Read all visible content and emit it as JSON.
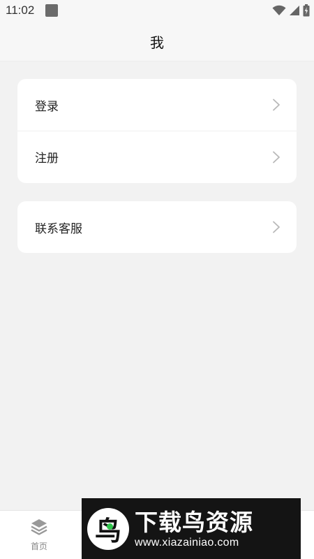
{
  "status_bar": {
    "time": "11:02",
    "icons": [
      "notification-icon",
      "wifi-icon",
      "signal-icon",
      "battery-charging-icon"
    ]
  },
  "header": {
    "title": "我"
  },
  "account_card": {
    "items": [
      {
        "label": "登录",
        "icon": "chevron-right-icon"
      },
      {
        "label": "注册",
        "icon": "chevron-right-icon"
      }
    ]
  },
  "support_card": {
    "items": [
      {
        "label": "联系客服",
        "icon": "chevron-right-icon"
      }
    ]
  },
  "tab_bar": {
    "home": {
      "label": "首页",
      "icon": "layers-icon"
    }
  },
  "watermark": {
    "logo_char": "鸟",
    "title": "下载鸟资源",
    "url": "www.xiazainiao.com"
  },
  "colors": {
    "background": "#f2f2f2",
    "card": "#ffffff",
    "chevron": "#b8b8b8",
    "watermark_bg": "#141414",
    "watermark_accent": "#2fc54b"
  }
}
